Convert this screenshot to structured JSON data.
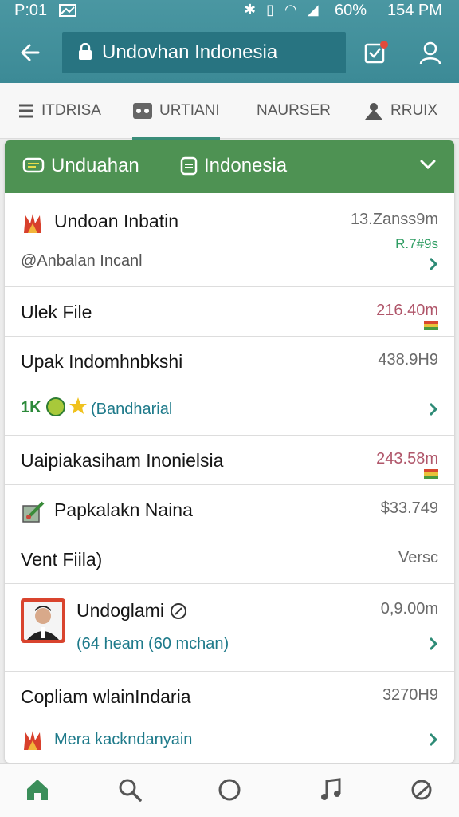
{
  "status": {
    "time": "P:01",
    "battery": "60%",
    "clock": "154 PM"
  },
  "toolbar": {
    "url": "Undovhan Indonesia"
  },
  "tabs": [
    {
      "label": "ITDRISA",
      "icon": "list-icon"
    },
    {
      "label": "URTIANI",
      "icon": "gamepad-icon"
    },
    {
      "label": "NAURSER",
      "icon": "none"
    },
    {
      "label": "RRUIX",
      "icon": "user-lock-icon"
    }
  ],
  "card": {
    "head_left": "Unduahan",
    "head_right": "Indonesia"
  },
  "rows": [
    {
      "title": "Undoan Inbatin",
      "meta": "13.Zanss9m",
      "sub": "@Anbalan Incanl",
      "sub2": "R.7#9s"
    },
    {
      "title": "Ulek File",
      "meta": "216.40m"
    },
    {
      "title": "Upak Indomhnbkshi",
      "meta": "438.9H9",
      "sub_prefix": "1K",
      "sub": "(Bandharial"
    },
    {
      "title": "Uaipiakasiham Inonielsia",
      "meta": "243.58m"
    },
    {
      "title": "Papkalakn Naina",
      "meta": "$33.749"
    },
    {
      "title": "Vent Fiila)",
      "meta": "Versc"
    },
    {
      "title": "Undoglami",
      "meta": "0,9.00m",
      "sub": "(64 heam (60 mchan)"
    },
    {
      "title": "Copliam wlainIndaria",
      "meta": "3270H9",
      "sub": "Mera kackndanyain"
    }
  ],
  "colors": {
    "appbar": "#3f8d98",
    "accent_green": "#4e9253",
    "link_teal": "#1e8a7a"
  }
}
